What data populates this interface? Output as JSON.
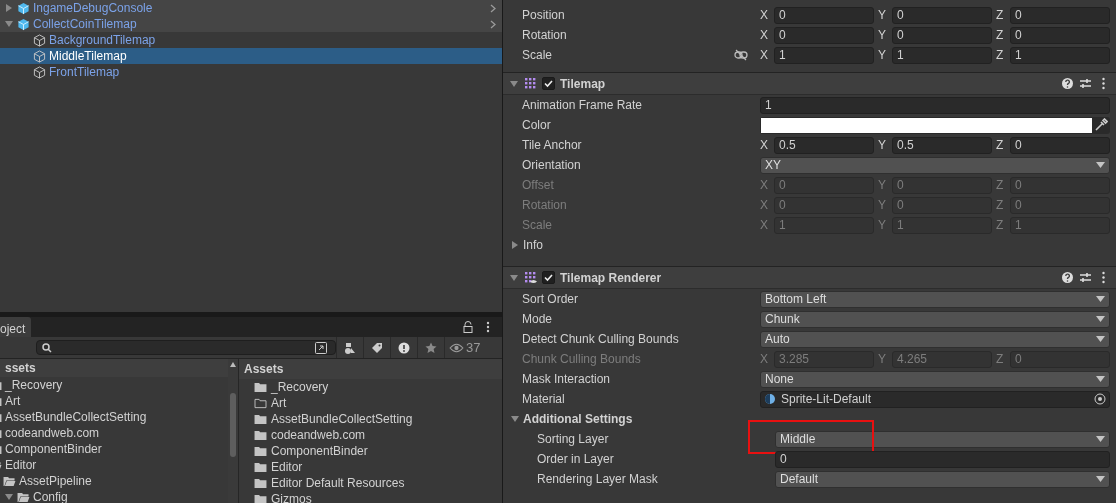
{
  "hierarchy": {
    "items": [
      {
        "label": "IngameDebugConsole",
        "kind": "prefab",
        "expanded": false,
        "selected": false
      },
      {
        "label": "CollectCoinTilemap",
        "kind": "prefab",
        "expanded": true,
        "selected": false,
        "children": [
          {
            "label": "BackgroundTilemap",
            "kind": "object",
            "selected": false
          },
          {
            "label": "MiddleTilemap",
            "kind": "object",
            "selected": true
          },
          {
            "label": "FrontTilemap",
            "kind": "object",
            "selected": false
          }
        ]
      }
    ]
  },
  "project": {
    "tab": "oject",
    "count": "37",
    "tree_header": "ssets",
    "tree": [
      {
        "label": "_Recovery"
      },
      {
        "label": "Art"
      },
      {
        "label": "AssetBundleCollectSetting"
      },
      {
        "label": "codeandweb.com"
      },
      {
        "label": "ComponentBinder"
      },
      {
        "label": "Editor",
        "children": [
          {
            "label": "AssetPipeline",
            "children": [
              {
                "label": "Config",
                "expanded": true
              }
            ]
          }
        ]
      }
    ],
    "list_header": "Assets",
    "list": [
      {
        "label": "_Recovery",
        "empty": false
      },
      {
        "label": "Art",
        "empty": true
      },
      {
        "label": "AssetBundleCollectSetting",
        "empty": false
      },
      {
        "label": "codeandweb.com",
        "empty": false
      },
      {
        "label": "ComponentBinder",
        "empty": false
      },
      {
        "label": "Editor",
        "empty": false
      },
      {
        "label": "Editor Default Resources",
        "empty": false
      },
      {
        "label": "Gizmos",
        "empty": false
      }
    ]
  },
  "inspector": {
    "transform": [
      {
        "label": "Position",
        "kind": "vector3",
        "fields": [
          {
            "axis": "X",
            "value": "0"
          },
          {
            "axis": "Y",
            "value": "0"
          },
          {
            "axis": "Z",
            "value": "0"
          }
        ],
        "disabled": false
      },
      {
        "label": "Rotation",
        "kind": "vector3",
        "fields": [
          {
            "axis": "X",
            "value": "0"
          },
          {
            "axis": "Y",
            "value": "0"
          },
          {
            "axis": "Z",
            "value": "0"
          }
        ],
        "disabled": false
      },
      {
        "label": "Scale",
        "kind": "vector3",
        "fields": [
          {
            "axis": "X",
            "value": "1"
          },
          {
            "axis": "Y",
            "value": "1"
          },
          {
            "axis": "Z",
            "value": "1"
          }
        ],
        "disabled": false,
        "linked": false
      }
    ],
    "components": [
      {
        "title": "Tilemap",
        "enabled": true,
        "expanded": true,
        "rows": [
          {
            "label": "Animation Frame Rate",
            "kind": "text",
            "value": "1",
            "disabled": false
          },
          {
            "label": "Color",
            "kind": "color",
            "disabled": false
          },
          {
            "label": "Tile Anchor",
            "kind": "vector3",
            "fields": [
              {
                "axis": "X",
                "value": "0.5"
              },
              {
                "axis": "Y",
                "value": "0.5"
              },
              {
                "axis": "Z",
                "value": "0"
              }
            ],
            "disabled": false
          },
          {
            "label": "Orientation",
            "kind": "dropdown",
            "value": "XY",
            "disabled": false
          },
          {
            "label": "Offset",
            "kind": "vector3",
            "fields": [
              {
                "axis": "X",
                "value": "0"
              },
              {
                "axis": "Y",
                "value": "0"
              },
              {
                "axis": "Z",
                "value": "0"
              }
            ],
            "disabled": true
          },
          {
            "label": "Rotation",
            "kind": "vector3",
            "fields": [
              {
                "axis": "X",
                "value": "0"
              },
              {
                "axis": "Y",
                "value": "0"
              },
              {
                "axis": "Z",
                "value": "0"
              }
            ],
            "disabled": true
          },
          {
            "label": "Scale",
            "kind": "vector3",
            "fields": [
              {
                "axis": "X",
                "value": "1"
              },
              {
                "axis": "Y",
                "value": "1"
              },
              {
                "axis": "Z",
                "value": "1"
              }
            ],
            "disabled": true
          },
          {
            "label": "Info",
            "kind": "foldout",
            "expanded": false,
            "disabled": false
          }
        ]
      },
      {
        "title": "Tilemap Renderer",
        "enabled": true,
        "expanded": true,
        "rows": [
          {
            "label": "Sort Order",
            "kind": "dropdown",
            "value": "Bottom Left",
            "disabled": false
          },
          {
            "label": "Mode",
            "kind": "dropdown",
            "value": "Chunk",
            "disabled": false
          },
          {
            "label": "Detect Chunk Culling Bounds",
            "kind": "dropdown",
            "value": "Auto",
            "disabled": false
          },
          {
            "label": "Chunk Culling Bounds",
            "kind": "vector3",
            "fields": [
              {
                "axis": "X",
                "value": "3.285"
              },
              {
                "axis": "Y",
                "value": "4.265"
              },
              {
                "axis": "Z",
                "value": "0"
              }
            ],
            "disabled": true
          },
          {
            "label": "Mask Interaction",
            "kind": "dropdown",
            "value": "None",
            "disabled": false
          },
          {
            "label": "Material",
            "kind": "object",
            "value": "Sprite-Lit-Default",
            "disabled": false
          },
          {
            "label": "Additional Settings",
            "kind": "foldout",
            "expanded": true,
            "disabled": false,
            "children": [
              {
                "label": "Sorting Layer",
                "kind": "dropdown",
                "value": "Middle",
                "disabled": false,
                "highlighted": true
              },
              {
                "label": "Order in Layer",
                "kind": "text",
                "value": "0",
                "disabled": false
              },
              {
                "label": "Rendering Layer Mask",
                "kind": "dropdown",
                "value": "Default",
                "disabled": false
              }
            ]
          }
        ]
      }
    ]
  }
}
